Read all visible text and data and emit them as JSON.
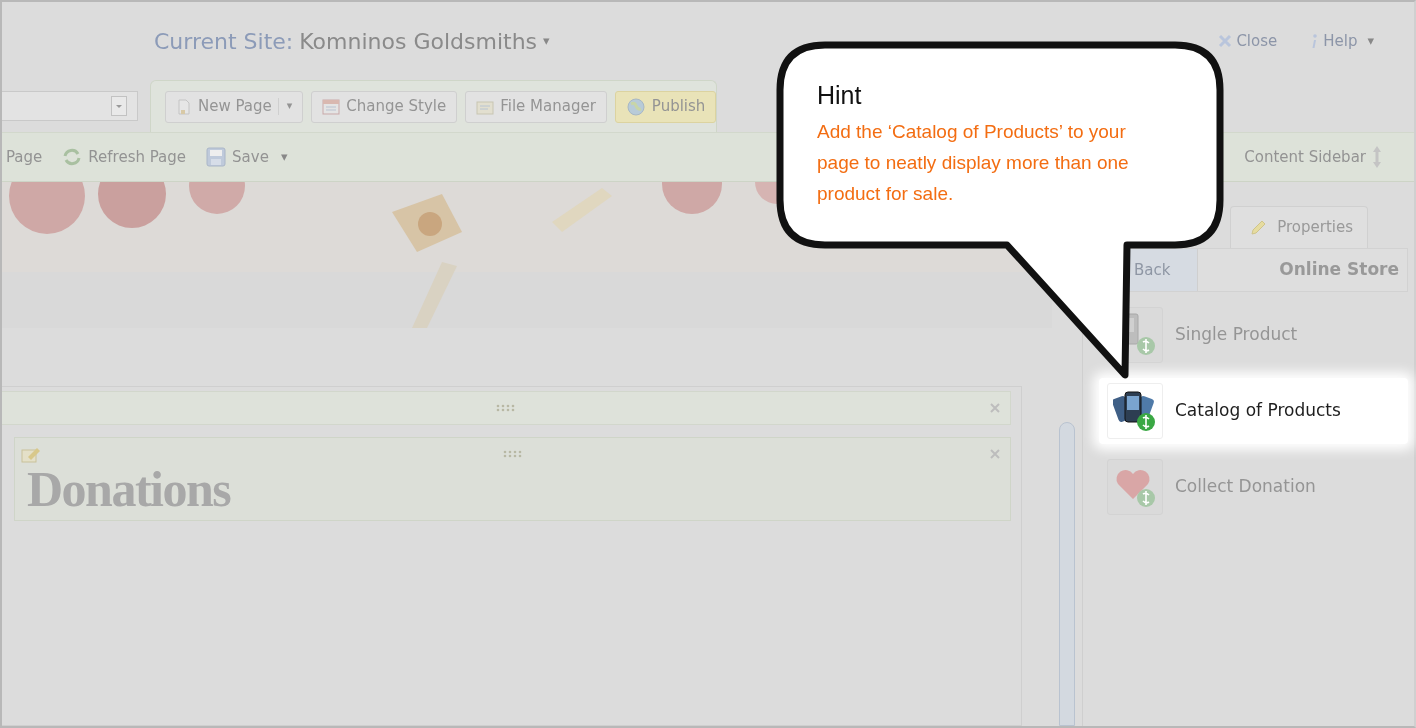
{
  "header": {
    "site_label": "Current Site:",
    "site_name": "Komninos Goldsmiths",
    "site_caret": "▾",
    "actions": [
      {
        "kind": "close",
        "label": "Close"
      },
      {
        "kind": "help",
        "label": "Help",
        "caret": "▾"
      }
    ]
  },
  "toolbar": {
    "buttons": [
      {
        "kind": "new",
        "label": "New Page",
        "split_caret": "▾",
        "highlighted": false
      },
      {
        "kind": "style",
        "label": "Change Style",
        "highlighted": false
      },
      {
        "kind": "files",
        "label": "File Manager",
        "highlighted": false
      },
      {
        "kind": "publish",
        "label": "Publish",
        "highlighted": true
      }
    ]
  },
  "subtoolbar": {
    "items": [
      {
        "kind": "plain",
        "label": "Page"
      },
      {
        "kind": "refresh",
        "label": "Refresh Page"
      },
      {
        "kind": "save",
        "label": "Save",
        "caret": "▾"
      }
    ],
    "sidebar_label": "Content Sidebar"
  },
  "content": {
    "heading": "Donations"
  },
  "sidebar": {
    "tab": "Properties",
    "back": "Back",
    "section_title": "Online Store",
    "items": [
      {
        "kind": "product",
        "label": "Single Product",
        "selected": false
      },
      {
        "kind": "catalog",
        "label": "Catalog of Products",
        "selected": true
      },
      {
        "kind": "donation",
        "label": "Collect Donation",
        "selected": false
      }
    ]
  },
  "hint": {
    "title": "Hint",
    "text": "Add the ‘Catalog of Products’ to your page to neatly display more than one product for sale."
  }
}
